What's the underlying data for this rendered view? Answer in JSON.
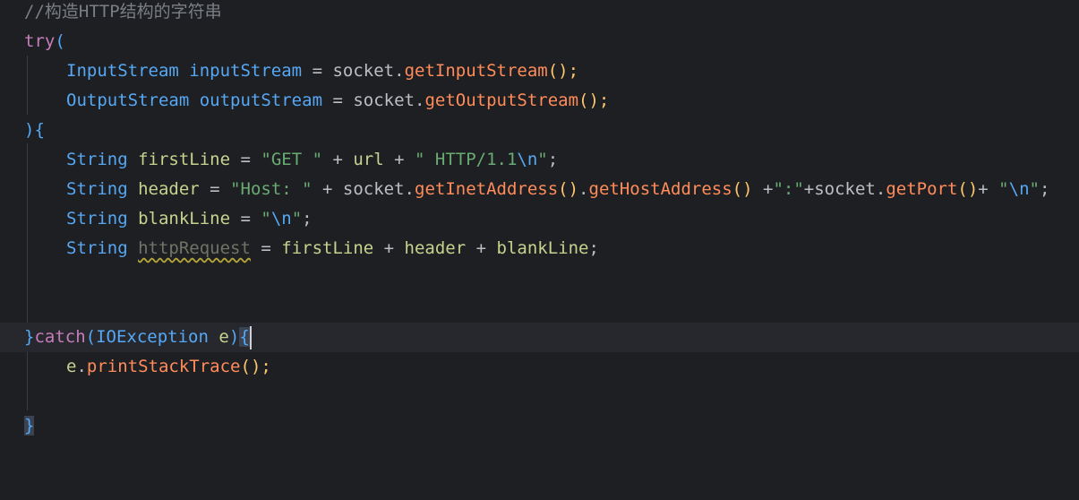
{
  "editor": {
    "comment": "//构造HTTP结构的字符串",
    "try_kw": "try",
    "open_paren": "(",
    "line_input": {
      "type": "InputStream",
      "name": "inputStream",
      "eq": " = ",
      "obj": "socket",
      "dot": ".",
      "method": "getInputStream",
      "tail": "();"
    },
    "line_output": {
      "type": "OutputStream",
      "name": "outputStream",
      "eq": " = ",
      "obj": "socket",
      "dot": ".",
      "method": "getOutputStream",
      "tail": "();"
    },
    "close_try": "){",
    "line_first": {
      "type": "String",
      "name": "firstLine",
      "eq": " = ",
      "s1": "\"GET \"",
      "plus1": " + ",
      "url": "url",
      "plus2": " + ",
      "s2a": "\" HTTP/1.1",
      "esc": "\\n",
      "s2b": "\"",
      "semi": ";"
    },
    "line_header": {
      "type": "String",
      "name": "header",
      "eq": " = ",
      "s1": "\"Host: \"",
      "plus1": " + ",
      "obj1": "socket",
      "dot1": ".",
      "m1": "getInetAddress",
      "p1": "()",
      "dot2": ".",
      "m2": "getHostAddress",
      "p2": "()",
      "plus2": " +",
      "s2": "\":\"",
      "plus3": "+",
      "obj2": "socket",
      "dot3": ".",
      "m3": "getPort",
      "p3": "()",
      "plus4": "+ ",
      "s3a": "\"",
      "esc": "\\n",
      "s3b": "\"",
      "semi": ";"
    },
    "line_blank": {
      "type": "String",
      "name": "blankLine",
      "eq": " = ",
      "s1a": "\"",
      "esc": "\\n",
      "s1b": "\"",
      "semi": ";"
    },
    "line_request": {
      "type": "String",
      "name": "httpRequest",
      "eq": " = ",
      "a": "firstLine",
      "plus1": " + ",
      "b": "header",
      "plus2": " + ",
      "c": "blankLine",
      "semi": ";"
    },
    "line_catch": {
      "close": "}",
      "kw": "catch",
      "open": "(",
      "type": "IOException",
      "var": "e",
      "close_paren": ")",
      "brace": "{"
    },
    "line_print": {
      "obj": "e",
      "dot": ".",
      "method": "printStackTrace",
      "tail": "();"
    },
    "last_brace": "}"
  },
  "colors": {
    "background": "#1e1f22",
    "current_line": "#26282e",
    "keyword": "#cf8e6d",
    "type": "#56a8f5",
    "string": "#6aab73",
    "method": "#ff8c5a",
    "comment": "#7a7e85"
  }
}
